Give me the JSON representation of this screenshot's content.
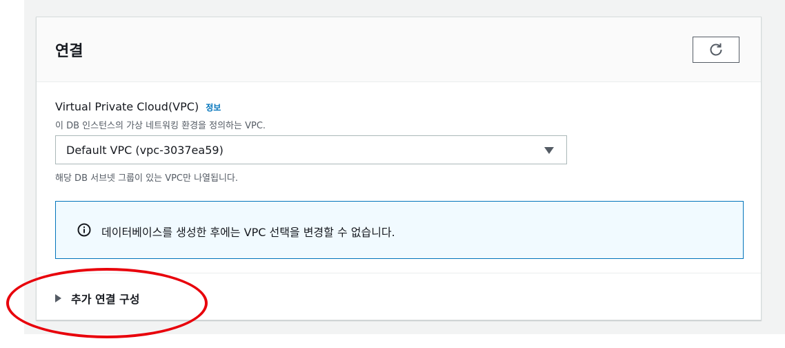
{
  "panel": {
    "title": "연결"
  },
  "vpc": {
    "label": "Virtual Private Cloud(VPC)",
    "info_link": "정보",
    "description": "이 DB 인스턴스의 가상 네트워킹 환경을 정의하는 VPC.",
    "selected_value": "Default VPC (vpc-3037ea59)",
    "hint": "해당 DB 서브넷 그룹이 있는 VPC만 나열됩니다."
  },
  "alert": {
    "message": "데이터베이스를 생성한 후에는 VPC 선택을 변경할 수 없습니다."
  },
  "expander": {
    "label": "추가 연결 구성"
  },
  "colors": {
    "accent": "#0073bb",
    "highlight": "#e8000b"
  }
}
